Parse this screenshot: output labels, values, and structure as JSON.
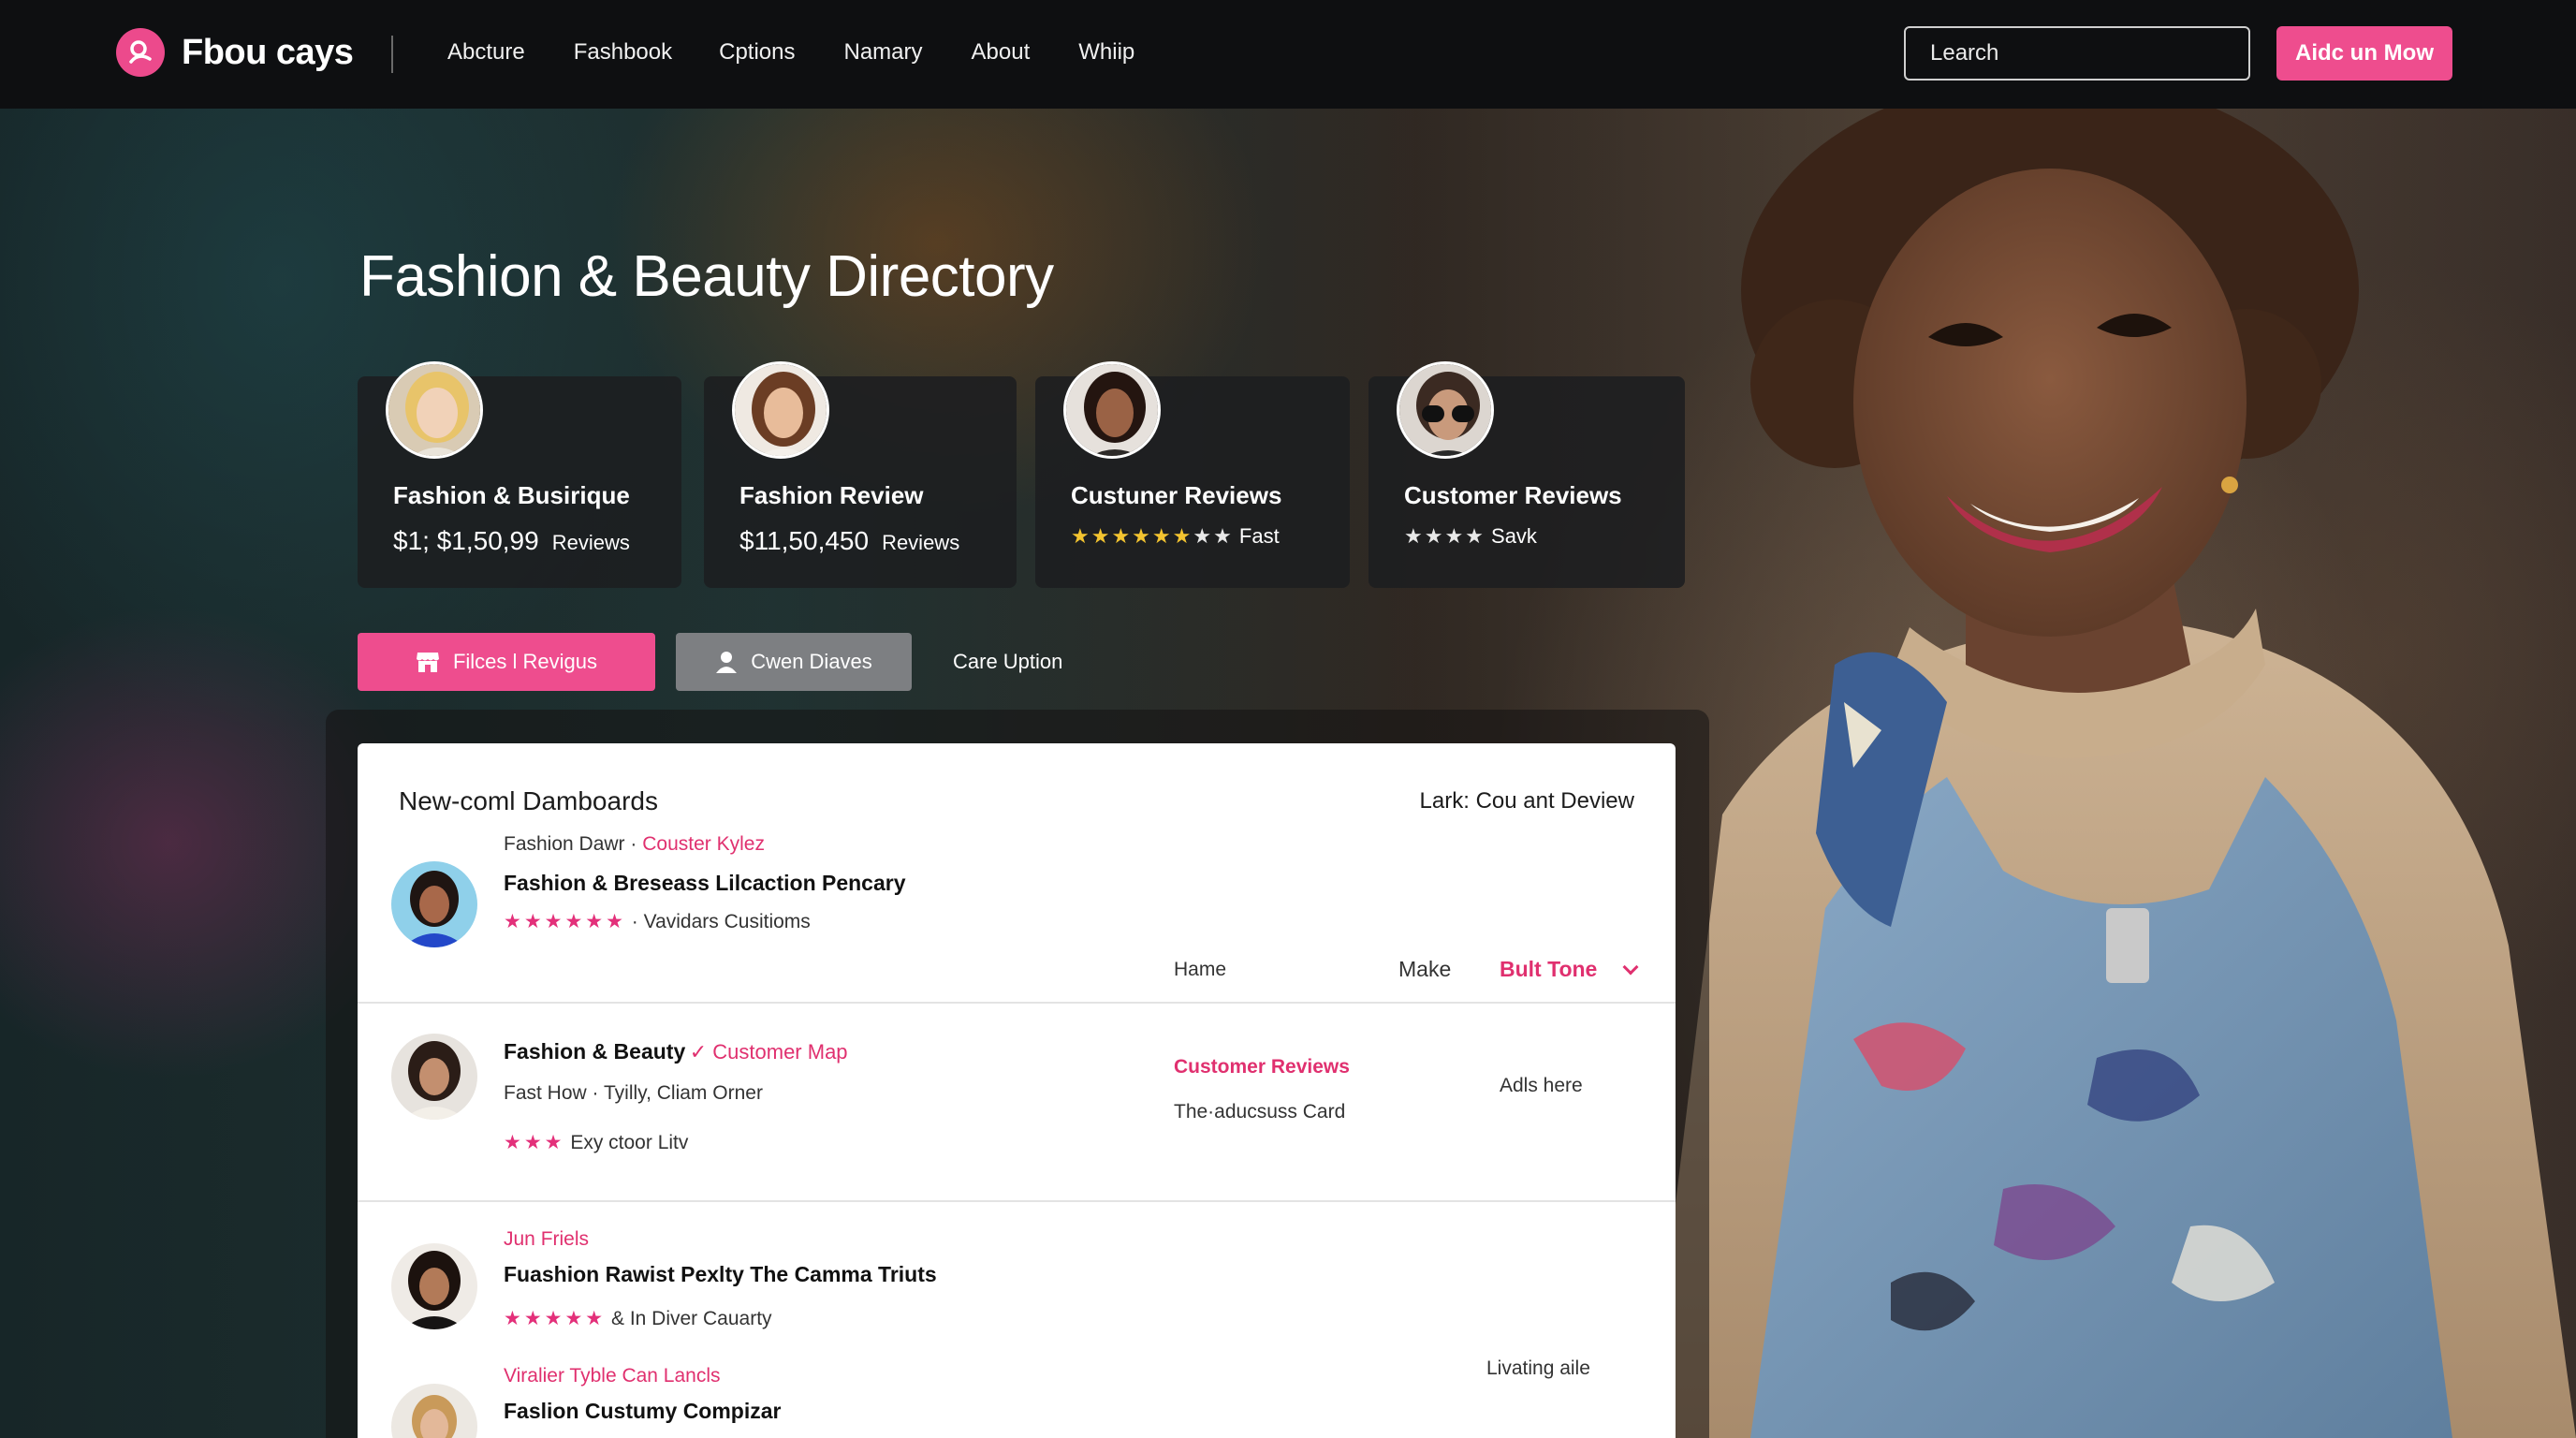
{
  "nav": {
    "brand": "Fbou cays",
    "links": [
      "Abcture",
      "Fashbook",
      "Cptions",
      "Namary",
      "About",
      "Whiip"
    ],
    "search_placeholder": "Learch",
    "cta": "Aidc un Mow"
  },
  "hero": {
    "title": "Fashion & Beauty Directory"
  },
  "cards": [
    {
      "title": "Fashion & Busirique",
      "value": "$1; $1,50,99",
      "suffix": "Reviews"
    },
    {
      "title": "Fashion Review",
      "value": "$11,50,450",
      "suffix": "Reviews"
    },
    {
      "title": "Custuner Reviews",
      "rating": "Fast",
      "stars": 7
    },
    {
      "title": "Customer Reviews",
      "rating": "Savk",
      "stars": 4
    }
  ],
  "filters": {
    "primary": "Filces l Revigus",
    "secondary": "Cwen Diaves",
    "tertiary": "Care Uption"
  },
  "panel": {
    "title": "New-coml Damboards",
    "right_label": "Lark: Cou ant Deview",
    "columns": {
      "home": "Hame",
      "make": "Make",
      "tone": "Bult Tone"
    },
    "rows": [
      {
        "meta": "Fashion Dawr",
        "meta_link": "Couster Kylez",
        "title": "Fashion & Breseass Lilcaction Pencary",
        "extra": "Vavidars Cusitioms"
      },
      {
        "title": "Fashion & Beauty",
        "title_link": "Customer Map",
        "meta": "Fast How",
        "meta2": "Tyilly, Cliam Orner",
        "extra": "Exy ctoor Litv",
        "col_link": "Customer Reviews",
        "col_text": "The·aducsuss Card",
        "col_right": "Adls here"
      },
      {
        "overline": "Jun Friels",
        "title": "Fuashion Rawist Pexlty The Camma Triuts",
        "extra": "& In Diver Cauarty"
      },
      {
        "overline": "Viralier Tyble Can Lancls",
        "title": "Faslion Custumy Compizar",
        "col_right": "Livating aile"
      }
    ]
  },
  "colors": {
    "accent": "#ee4d8e",
    "nav_bg": "#0e0f11",
    "star_yellow": "#f4c430",
    "star_pink": "#e3307a"
  }
}
